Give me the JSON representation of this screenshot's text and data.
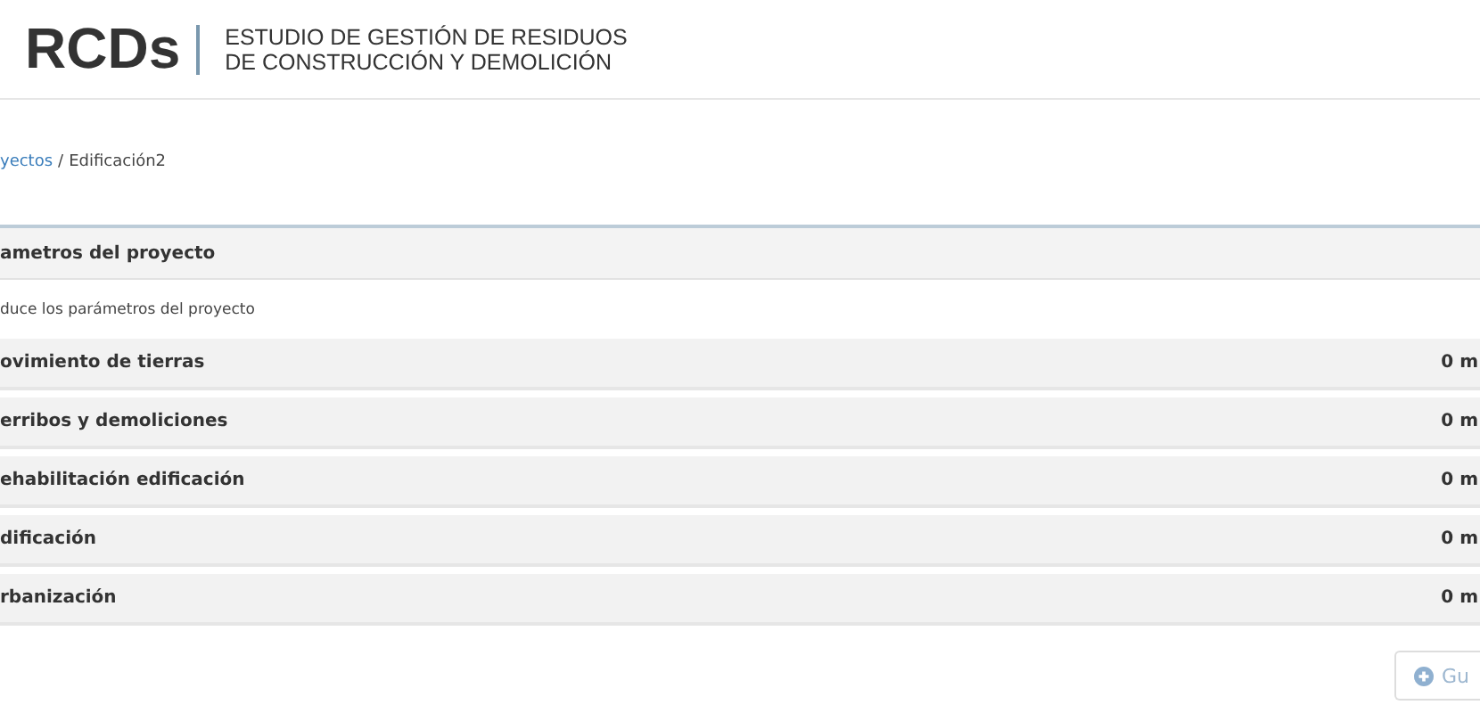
{
  "header": {
    "logo": "RCDs",
    "subtitle_lines": [
      "ESTUDIO DE GESTIÓN DE RESIDUOS",
      "DE CONSTRUCCIÓN Y DEMOLICIÓN"
    ]
  },
  "breadcrumb": {
    "link": "yectos",
    "separator": "/",
    "current": "Edificación2"
  },
  "panel": {
    "title": "ametros del proyecto",
    "description": "duce los parámetros del proyecto"
  },
  "rows": [
    {
      "label": "ovimiento de tierras",
      "value": "0 m"
    },
    {
      "label": "erribos y demoliciones",
      "value": "0 m"
    },
    {
      "label": "ehabilitación edificación",
      "value": "0 m"
    },
    {
      "label": "dificación",
      "value": "0 m"
    },
    {
      "label": "rbanización",
      "value": "0 m"
    }
  ],
  "save_button": {
    "label": "Gu"
  }
}
